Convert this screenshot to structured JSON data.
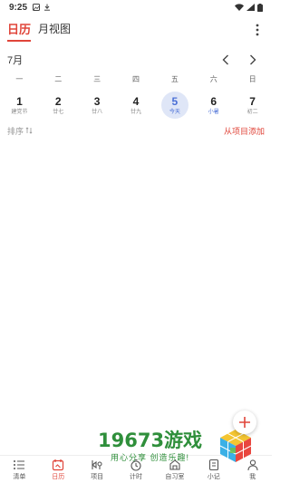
{
  "status_bar": {
    "time": "9:25"
  },
  "header": {
    "tabs": [
      {
        "label": "日历"
      },
      {
        "label": "月视图"
      }
    ]
  },
  "calendar": {
    "month_label": "7月",
    "weekdays": [
      "一",
      "二",
      "三",
      "四",
      "五",
      "六",
      "日"
    ],
    "dates": [
      {
        "day": "1",
        "sub": "建党节"
      },
      {
        "day": "2",
        "sub": "廿七"
      },
      {
        "day": "3",
        "sub": "廿八"
      },
      {
        "day": "4",
        "sub": "廿九"
      },
      {
        "day": "5",
        "sub": "今天"
      },
      {
        "day": "6",
        "sub": "小暑"
      },
      {
        "day": "7",
        "sub": "初二"
      }
    ]
  },
  "toolbar": {
    "sort_label": "排序",
    "add_from_project_label": "从项目添加"
  },
  "watermark": {
    "main": "19673游戏",
    "sub": "用心分享 创造乐趣!"
  },
  "bottom_nav": [
    {
      "label": "清单",
      "icon": "list-icon"
    },
    {
      "label": "日历",
      "icon": "calendar-icon"
    },
    {
      "label": "项目",
      "icon": "project-icon"
    },
    {
      "label": "计时",
      "icon": "timer-icon"
    },
    {
      "label": "自习室",
      "icon": "study-room-icon"
    },
    {
      "label": "小记",
      "icon": "notes-icon"
    },
    {
      "label": "我",
      "icon": "profile-icon"
    }
  ],
  "colors": {
    "accent": "#e0453a",
    "today": "#4a6fd6",
    "today_bg": "#dfe6f7",
    "watermark": "#2f8f3b"
  }
}
